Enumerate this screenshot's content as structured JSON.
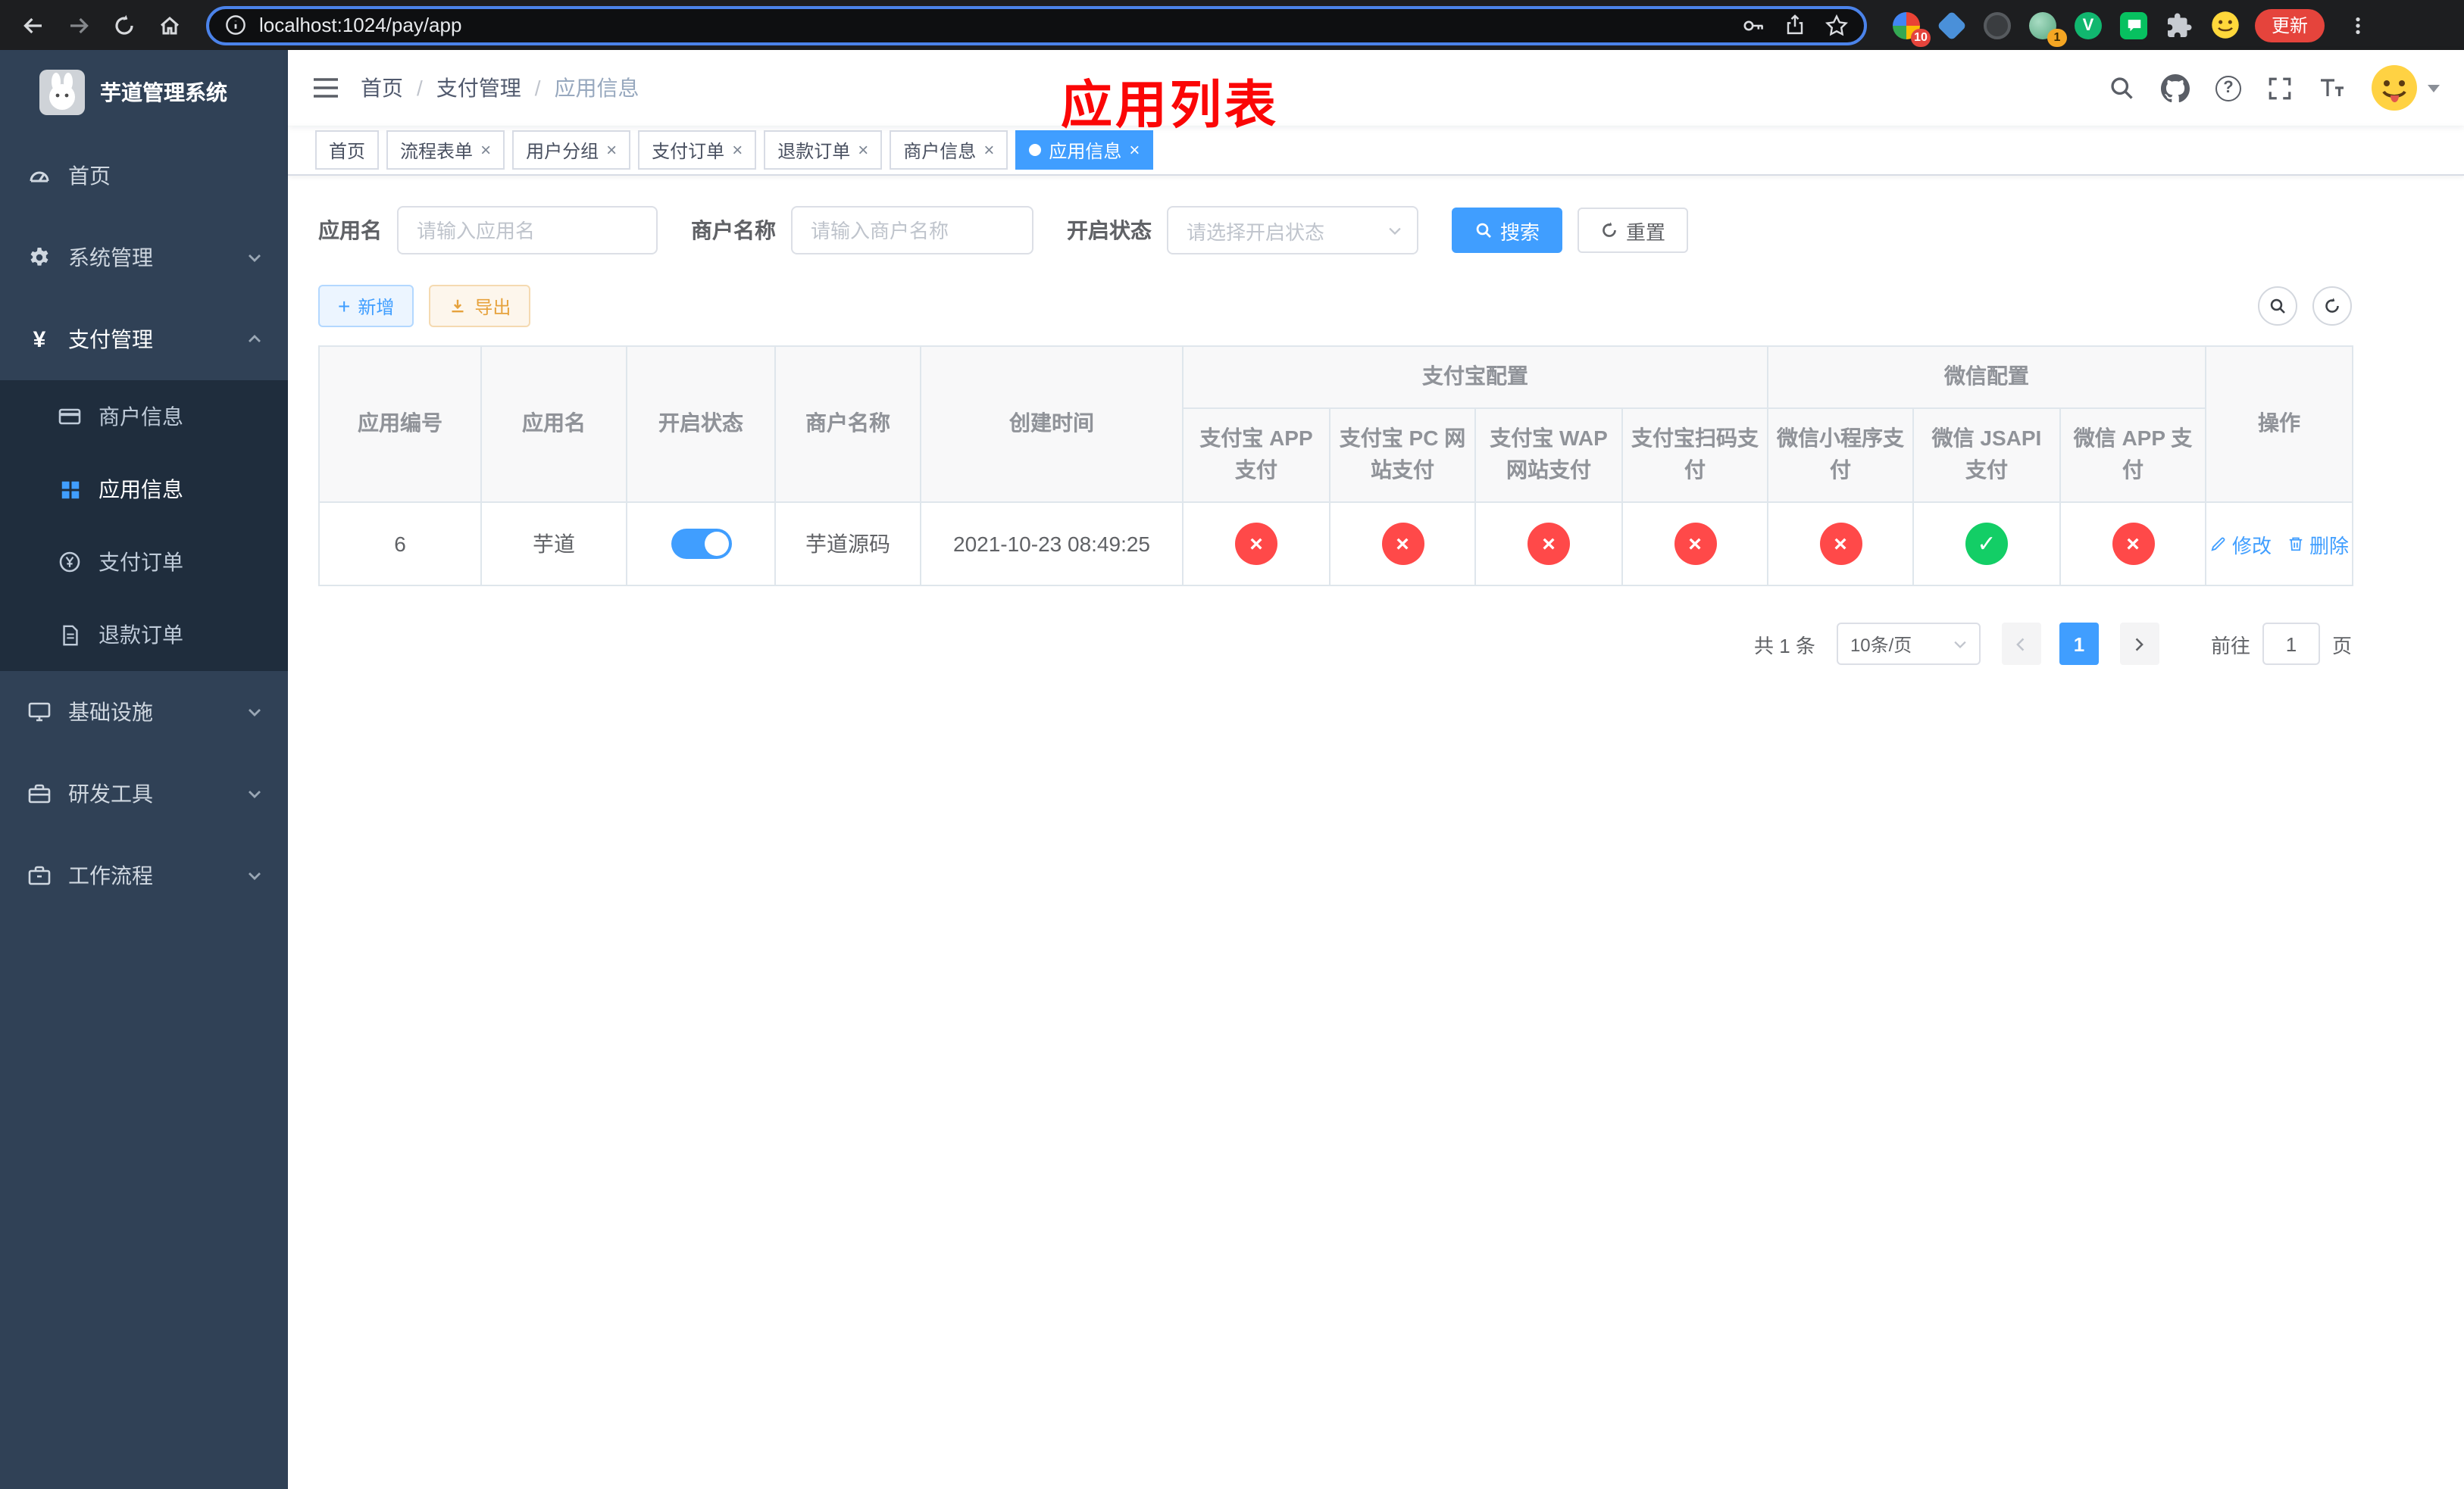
{
  "browser": {
    "url": "localhost:1024/pay/app",
    "update_button": "更新",
    "ext_badge_1": "10",
    "ext_badge_2": "1"
  },
  "sidebar": {
    "title": "芋道管理系统",
    "menu": [
      {
        "label": "首页"
      },
      {
        "label": "系统管理"
      },
      {
        "label": "支付管理"
      },
      {
        "label": "基础设施"
      },
      {
        "label": "研发工具"
      },
      {
        "label": "工作流程"
      }
    ],
    "submenu": [
      {
        "label": "商户信息"
      },
      {
        "label": "应用信息"
      },
      {
        "label": "支付订单"
      },
      {
        "label": "退款订单"
      }
    ]
  },
  "navbar": {
    "breadcrumb": {
      "home": "首页",
      "section": "支付管理",
      "current": "应用信息",
      "separator": "/"
    },
    "overlay_title": "应用列表"
  },
  "tabs": [
    {
      "label": "首页"
    },
    {
      "label": "流程表单"
    },
    {
      "label": "用户分组"
    },
    {
      "label": "支付订单"
    },
    {
      "label": "退款订单"
    },
    {
      "label": "商户信息"
    },
    {
      "label": "应用信息"
    }
  ],
  "filters": {
    "app_name": {
      "label": "应用名",
      "placeholder": "请输入应用名"
    },
    "merchant_name": {
      "label": "商户名称",
      "placeholder": "请输入商户名称"
    },
    "status": {
      "label": "开启状态",
      "placeholder": "请选择开启状态"
    },
    "search_button": "搜索",
    "reset_button": "重置"
  },
  "toolbar": {
    "add_button": "新增",
    "export_button": "导出"
  },
  "table": {
    "columns": {
      "app_id": "应用编号",
      "app_name": "应用名",
      "status": "开启状态",
      "merchant": "商户名称",
      "created": "创建时间",
      "alipay_group": "支付宝配置",
      "wechat_group": "微信配置",
      "actions": "操作",
      "alipay_app": "支付宝 APP 支付",
      "alipay_pc": "支付宝 PC 网站支付",
      "alipay_wap": "支付宝 WAP 网站支付",
      "alipay_qr": "支付宝扫码支付",
      "wechat_mini": "微信小程序支付",
      "wechat_jsapi": "微信 JSAPI 支付",
      "wechat_app": "微信 APP 支付"
    },
    "rows": [
      {
        "app_id": "6",
        "app_name": "芋道",
        "enabled": true,
        "merchant": "芋道源码",
        "created": "2021-10-23 08:49:25",
        "alipay_app": "disabled",
        "alipay_pc": "disabled",
        "alipay_wap": "disabled",
        "alipay_qr": "disabled",
        "wechat_mini": "disabled",
        "wechat_jsapi": "enabled",
        "wechat_app": "disabled",
        "edit_action": "修改",
        "delete_action": "删除"
      }
    ]
  },
  "pagination": {
    "total_text": "共 1 条",
    "page_size": "10条/页",
    "current_page": "1",
    "goto_prefix": "前往",
    "goto_value": "1",
    "goto_suffix": "页"
  }
}
